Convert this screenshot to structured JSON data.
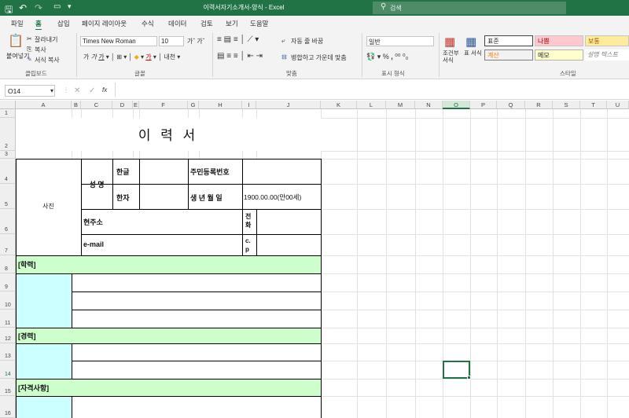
{
  "titlebar": {
    "doc_title": "이력서자기소개서-양식 - Excel",
    "search_placeholder": "검색",
    "undo_icon": "↶",
    "redo_icon": "↷"
  },
  "tabs": [
    "파일",
    "홈",
    "삽입",
    "페이지 레이아웃",
    "수식",
    "데이터",
    "검토",
    "보기",
    "도움말"
  ],
  "ribbon": {
    "paste": "붙여넣기",
    "cut": "잘라내기",
    "copy": "복사",
    "format_painter": "서식 복사",
    "clipboard_group": "클립보드",
    "font_name": "Times New Roman",
    "font_size": "10",
    "font_group": "글꼴",
    "wrap_text": "자동 줄 바꿈",
    "merge_center": "병합하고 가운데 맞춤",
    "align_group": "맞춤",
    "number_format": "일반",
    "number_group": "표시 형식",
    "conditional_format": "조건부 서식",
    "table_format": "표 서식",
    "style_normal": "표준",
    "style_bad": "나쁨",
    "style_good": "보통",
    "style_calc": "계산",
    "style_memo": "메모",
    "style_explain": "설명 텍스트",
    "style_group": "스타일",
    "normal_color": "#ffffff",
    "bad_color": "#ffc7ce",
    "good_color": "#ffeb9c",
    "calc_color": "#f2f2f2"
  },
  "formula_bar": {
    "name_box": "O14",
    "fx": "fx",
    "formula": ""
  },
  "columns": [
    "A",
    "B",
    "C",
    "D",
    "E",
    "F",
    "G",
    "H",
    "I",
    "J",
    "K",
    "L",
    "M",
    "N",
    "O",
    "P",
    "Q",
    "R",
    "S",
    "T",
    "U"
  ],
  "rows": [
    "1",
    "2",
    "3",
    "4",
    "5",
    "6",
    "7",
    "8",
    "9",
    "10",
    "11",
    "12",
    "13",
    "14",
    "15",
    "16"
  ],
  "selected_cell": "O14",
  "sheet": {
    "title": "이  력  서",
    "photo": "사진",
    "name_label": "성  명",
    "hangul_label": "한글",
    "hanja_label": "한자",
    "rrn_label": "주민등록번호",
    "birth_label": "생 년 월 일",
    "birth_value": "1900.00.00(만00세)",
    "address_label": "현주소",
    "phone_label": "전화",
    "email_label": "e-mail",
    "cp_label": "c.p",
    "education_header": "[학력]",
    "career_header": "[경력]",
    "cert_header": "[자격사항]"
  },
  "accent": "#217346",
  "section_fill": "#ccffcc",
  "date_fill": "#ccffff"
}
